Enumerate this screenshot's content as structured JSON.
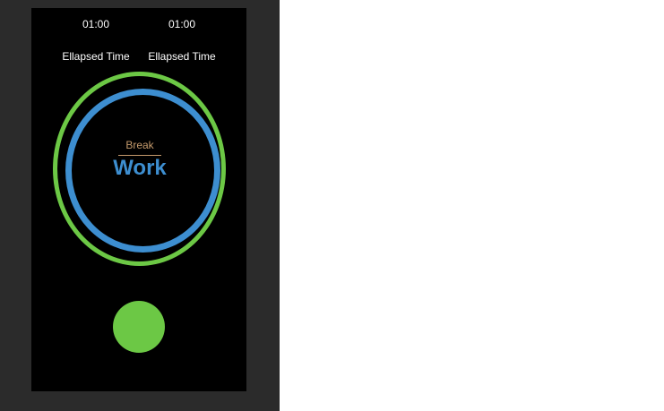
{
  "timers": {
    "left_time": "01:00",
    "right_time": "01:00",
    "left_label": "Ellapsed Time",
    "right_label": "Ellapsed Time"
  },
  "center": {
    "break_label": "Break",
    "work_label": "Work"
  },
  "colors": {
    "outer_ring": "#6cc845",
    "inner_ring": "#3d8ed0",
    "break_text": "#c49a6c",
    "work_text": "#3d8ed0",
    "start_button": "#6cc845",
    "screen_background": "#000000",
    "frame_background": "#2b2b2b"
  }
}
